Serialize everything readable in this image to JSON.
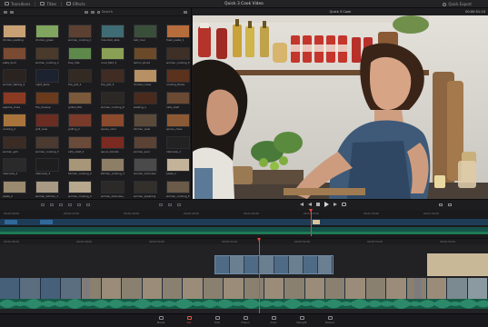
{
  "topbar": {
    "app_title": "Quick 3 Cook Video",
    "buttons": [
      {
        "label": "Transitions",
        "icon": "transitions-icon"
      },
      {
        "label": "Titles",
        "icon": "titles-icon"
      },
      {
        "label": "Effects",
        "icon": "effects-icon"
      }
    ],
    "quick_export": "Quick Export"
  },
  "pool": {
    "search_label": "Search",
    "thumbs": [
      {
        "label": "chicken_walking",
        "color": "#c7a073"
      },
      {
        "label": "chicken_green",
        "color": "#7fa55e"
      },
      {
        "label": "woman_cooking_1",
        "color": "#5c4032"
      },
      {
        "label": "mountain_lake",
        "color": "#3f6c74"
      },
      {
        "label": "bell_river",
        "color": "#3a4f3a"
      },
      {
        "label": "fresh_pasta_1",
        "color": "#b76c3c"
      },
      {
        "label": "plate_food",
        "color": "#7a4a32"
      },
      {
        "label": "woman_cooking_2",
        "color": "#4a3a2c"
      },
      {
        "label": "tree_hills",
        "color": "#5d8a4b"
      },
      {
        "label": "rural_field_4",
        "color": "#8aa155"
      },
      {
        "label": "lemon_sliced",
        "color": "#6b4a2a"
      },
      {
        "label": "woman_cooking_5",
        "color": "#3e3027"
      },
      {
        "label": "woman_talking_2",
        "color": "#2a2320"
      },
      {
        "label": "night_stars",
        "color": "#1c2230"
      },
      {
        "label": "fire_grill_2",
        "color": "#332a24"
      },
      {
        "label": "fire_grill_3",
        "color": "#402c22"
      },
      {
        "label": "chicken_close",
        "color": "#b79064"
      },
      {
        "label": "cooking_flame",
        "color": "#5b321e"
      },
      {
        "label": "paprika_close",
        "color": "#8a3a22"
      },
      {
        "label": "fire_closeup",
        "color": "#6a3a1c"
      },
      {
        "label": "grilled_flat",
        "color": "#7a5a3a"
      },
      {
        "label": "woman_cooking_8",
        "color": "#2b2825"
      },
      {
        "label": "walking_1",
        "color": "#4a2a1c"
      },
      {
        "label": "cafe_shelf",
        "color": "#6b4a34"
      },
      {
        "label": "cooking_2",
        "color": "#a8743c"
      },
      {
        "label": "grill_view",
        "color": "#6b2c22"
      },
      {
        "label": "grilling_2",
        "color": "#7a3a2a"
      },
      {
        "label": "spices_color",
        "color": "#8b4a2c"
      },
      {
        "label": "kitchen_view",
        "color": "#5b4a3a"
      },
      {
        "label": "spices_close",
        "color": "#8b5a34"
      },
      {
        "label": "woman_grill",
        "color": "#3a2c25"
      },
      {
        "label": "woman_cooking_3",
        "color": "#4a3a30"
      },
      {
        "label": "cafe_shelf_2",
        "color": "#6a4a38"
      },
      {
        "label": "sauce_tomato",
        "color": "#7a2a20"
      },
      {
        "label": "woman_pour",
        "color": "#5a4234"
      },
      {
        "label": "interview_1",
        "color": "#222"
      },
      {
        "label": "interview_2",
        "color": "#2a2a2a"
      },
      {
        "label": "interview_3",
        "color": "#1e1e1e"
      },
      {
        "label": "kitchen_cooking_2",
        "color": "#a79678"
      },
      {
        "label": "kitchen_cooking_3",
        "color": "#8d7e66"
      },
      {
        "label": "woman_interview",
        "color": "#4a4a4a"
      },
      {
        "label": "pasta_1",
        "color": "#c3b398"
      },
      {
        "label": "pasta_2",
        "color": "#9a8a70"
      },
      {
        "label": "woman_kitchen_1",
        "color": "#a89a84"
      },
      {
        "label": "woman_cooking_4",
        "color": "#b7a88e"
      },
      {
        "label": "woman_interview_2",
        "color": "#2c2a28"
      },
      {
        "label": "woman_speaking",
        "color": "#33302c"
      },
      {
        "label": "woman_cooking_5",
        "color": "#6a5a48"
      }
    ]
  },
  "viewer": {
    "clip_name": "Quick 3 Cook",
    "timecode": "00:00:51:10"
  },
  "timeline_top": {
    "ticks": [
      "00:00:00:00",
      "00:00:15:00",
      "00:00:30:00",
      "00:00:45:00",
      "00:01:00:00",
      "00:01:15:00",
      "00:01:30:00",
      "00:01:45:00"
    ]
  },
  "timeline_bottom": {
    "ticks": [
      "00:00:48:00",
      "00:00:49:00",
      "00:00:50:00",
      "00:00:51:00",
      "00:00:52:00",
      "00:00:53:00",
      "00:00:54:00"
    ]
  },
  "pages": [
    {
      "label": "Media",
      "icon": "media-page-icon",
      "active": false
    },
    {
      "label": "Cut",
      "icon": "cut-page-icon",
      "active": true
    },
    {
      "label": "Edit",
      "icon": "edit-page-icon",
      "active": false
    },
    {
      "label": "Fusion",
      "icon": "fusion-page-icon",
      "active": false
    },
    {
      "label": "Color",
      "icon": "color-page-icon",
      "active": false
    },
    {
      "label": "Fairlight",
      "icon": "fairlight-page-icon",
      "active": false
    },
    {
      "label": "Deliver",
      "icon": "deliver-page-icon",
      "active": false
    }
  ]
}
